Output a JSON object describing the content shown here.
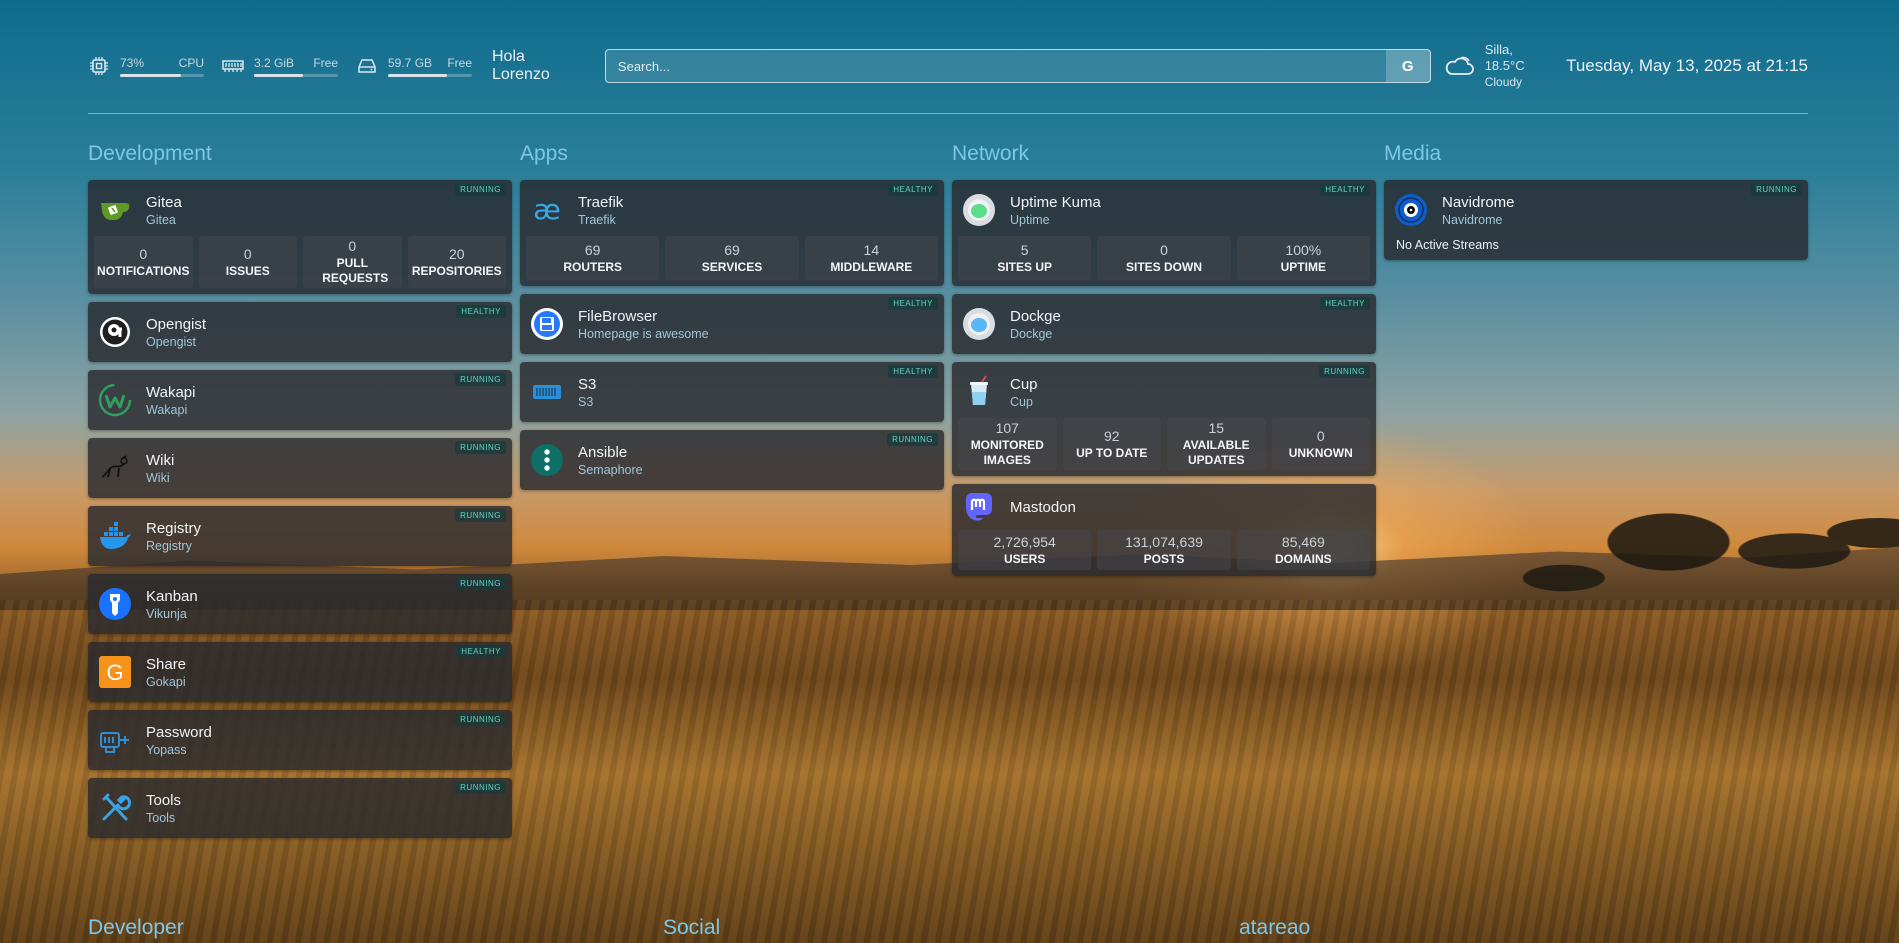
{
  "header": {
    "cpu": {
      "value": "73%",
      "label": "CPU",
      "percent": 73
    },
    "ram": {
      "value": "3.2 GiB",
      "label": "Free",
      "percent": 58
    },
    "disk": {
      "value": "59.7 GB",
      "label": "Free",
      "percent": 70
    },
    "greeting": "Hola Lorenzo",
    "search_placeholder": "Search...",
    "search_engine_label": "G",
    "weather": {
      "location": "Silla, 18.5°C",
      "condition": "Cloudy"
    },
    "datetime": "Tuesday, May 13, 2025 at 21:15"
  },
  "columns": [
    {
      "title": "Development",
      "cards": [
        {
          "name": "Gitea",
          "sub": "Gitea",
          "status": "RUNNING",
          "icon": "gitea-icon",
          "stats": [
            {
              "value": "0",
              "label": "NOTIFICATIONS"
            },
            {
              "value": "0",
              "label": "ISSUES"
            },
            {
              "value": "0",
              "label": "PULL REQUESTS"
            },
            {
              "value": "20",
              "label": "REPOSITORIES"
            }
          ]
        },
        {
          "name": "Opengist",
          "sub": "Opengist",
          "status": "HEALTHY",
          "icon": "opengist-icon"
        },
        {
          "name": "Wakapi",
          "sub": "Wakapi",
          "status": "RUNNING",
          "icon": "wakapi-icon"
        },
        {
          "name": "Wiki",
          "sub": "Wiki",
          "status": "RUNNING",
          "icon": "wiki-icon"
        },
        {
          "name": "Registry",
          "sub": "Registry",
          "status": "RUNNING",
          "icon": "docker-icon"
        },
        {
          "name": "Kanban",
          "sub": "Vikunja",
          "status": "RUNNING",
          "icon": "vikunja-icon"
        },
        {
          "name": "Share",
          "sub": "Gokapi",
          "status": "HEALTHY",
          "icon": "gokapi-icon"
        },
        {
          "name": "Password",
          "sub": "Yopass",
          "status": "RUNNING",
          "icon": "yopass-icon"
        },
        {
          "name": "Tools",
          "sub": "Tools",
          "status": "RUNNING",
          "icon": "tools-icon"
        }
      ]
    },
    {
      "title": "Apps",
      "cards": [
        {
          "name": "Traefik",
          "sub": "Traefik",
          "status": "HEALTHY",
          "icon": "traefik-icon",
          "stats": [
            {
              "value": "69",
              "label": "ROUTERS"
            },
            {
              "value": "69",
              "label": "SERVICES"
            },
            {
              "value": "14",
              "label": "MIDDLEWARE"
            }
          ]
        },
        {
          "name": "FileBrowser",
          "sub": "Homepage is awesome",
          "status": "HEALTHY",
          "icon": "filebrowser-icon"
        },
        {
          "name": "S3",
          "sub": "S3",
          "status": "HEALTHY",
          "icon": "s3-icon"
        },
        {
          "name": "Ansible",
          "sub": "Semaphore",
          "status": "RUNNING",
          "icon": "semaphore-icon"
        }
      ]
    },
    {
      "title": "Network",
      "cards": [
        {
          "name": "Uptime Kuma",
          "sub": "Uptime",
          "status": "HEALTHY",
          "icon": "uptime-kuma-icon",
          "stats": [
            {
              "value": "5",
              "label": "SITES UP"
            },
            {
              "value": "0",
              "label": "SITES DOWN"
            },
            {
              "value": "100%",
              "label": "UPTIME"
            }
          ]
        },
        {
          "name": "Dockge",
          "sub": "Dockge",
          "status": "HEALTHY",
          "icon": "dockge-icon"
        },
        {
          "name": "Cup",
          "sub": "Cup",
          "status": "RUNNING",
          "icon": "cup-icon",
          "stats": [
            {
              "value": "107",
              "label": "MONITORED IMAGES"
            },
            {
              "value": "92",
              "label": "UP TO DATE"
            },
            {
              "value": "15",
              "label": "AVAILABLE UPDATES"
            },
            {
              "value": "0",
              "label": "UNKNOWN"
            }
          ]
        },
        {
          "name": "Mastodon",
          "sub": "",
          "status": "",
          "icon": "mastodon-icon",
          "stats": [
            {
              "value": "2,726,954",
              "label": "USERS"
            },
            {
              "value": "131,074,639",
              "label": "POSTS"
            },
            {
              "value": "85,469",
              "label": "DOMAINS"
            }
          ]
        }
      ]
    },
    {
      "title": "Media",
      "cards": [
        {
          "name": "Navidrome",
          "sub": "Navidrome",
          "status": "RUNNING",
          "icon": "navidrome-icon",
          "note": "No Active Streams"
        }
      ]
    }
  ],
  "footer_sections": [
    "Developer",
    "Social",
    "atareao"
  ]
}
